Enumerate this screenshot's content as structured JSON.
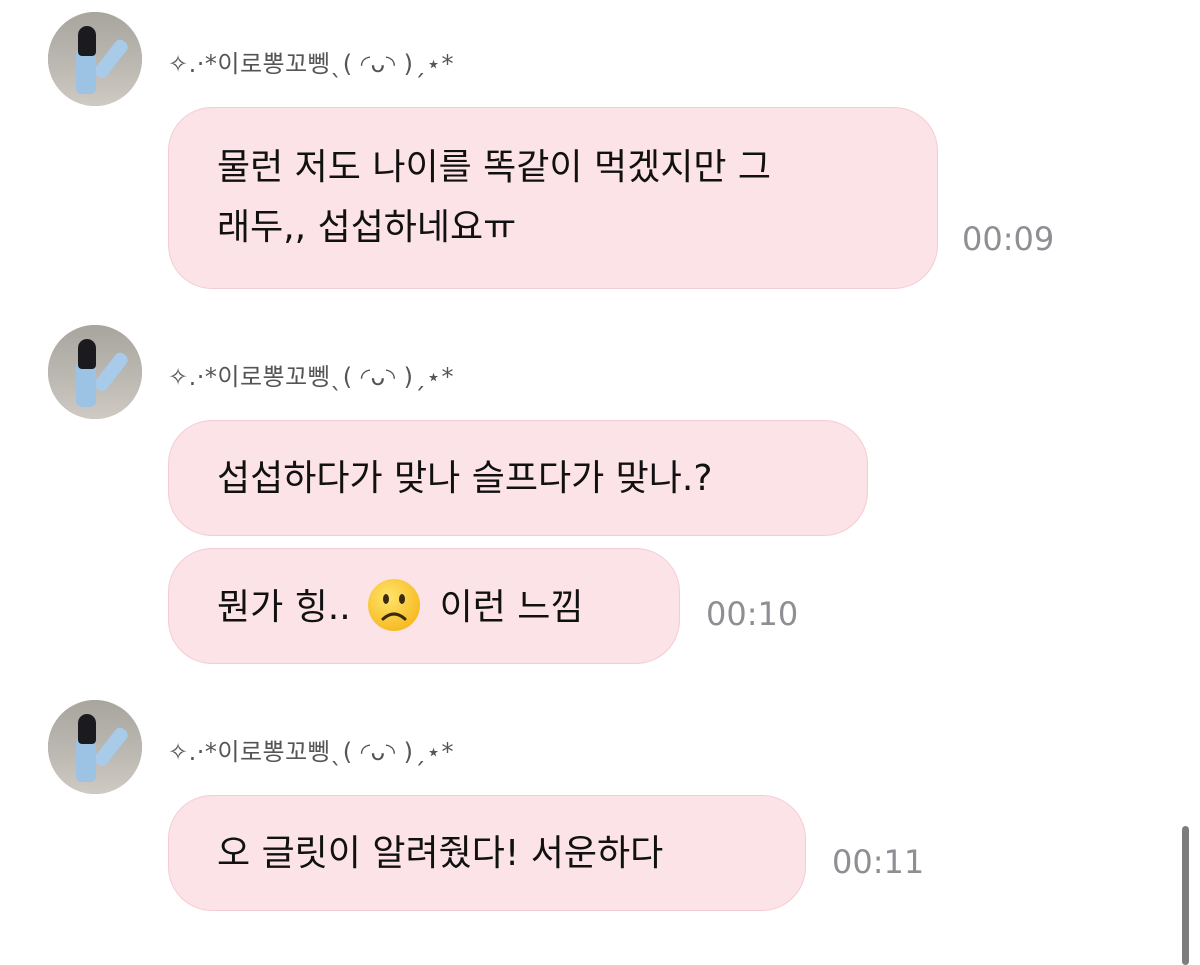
{
  "messages": [
    {
      "sender": "✧.·*이로뽕꼬뼁ˎ( ◜ᴗ◝ )ˏ⋆*",
      "bubbles": [
        {
          "line1": "물런 저도 나이를 똑같이 먹겠지만 그",
          "line2": "래두,, 섭섭하네요ㅠ",
          "time": "00:09"
        }
      ]
    },
    {
      "sender": "✧.·*이로뽕꼬뼁ˎ( ◜ᴗ◝ )ˏ⋆*",
      "bubbles": [
        {
          "text": "섭섭하다가 맞나 슬프다가 맞나.?"
        },
        {
          "text_before": "뭔가 힝..",
          "emoji": "frowning-face-emoji",
          "text_after": "이런 느낌",
          "time": "00:10"
        }
      ]
    },
    {
      "sender": "✧.·*이로뽕꼬뼁ˎ( ◜ᴗ◝ )ˏ⋆*",
      "bubbles": [
        {
          "text": "오 글릿이 알려줬다! 서운하다",
          "time": "00:11"
        }
      ]
    }
  ],
  "colors": {
    "bubble_bg": "#fbe3e7",
    "bubble_border": "#f5ccd3",
    "time_text": "#8e8e93",
    "sender_text": "#555555"
  }
}
